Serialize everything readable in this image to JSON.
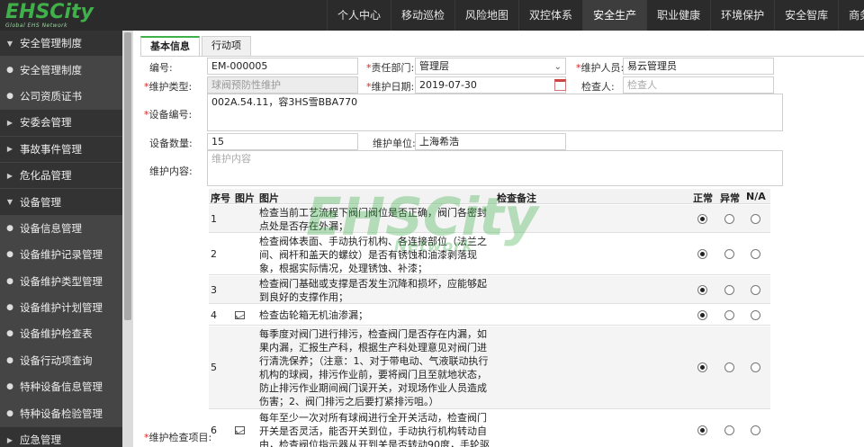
{
  "app": {
    "logo_text": "EHSCity",
    "logo_subtitle": "Global EHS Network"
  },
  "nav": {
    "items": [
      {
        "label": "个人中心"
      },
      {
        "label": "移动巡检"
      },
      {
        "label": "风险地图"
      },
      {
        "label": "双控体系"
      },
      {
        "label": "安全生产"
      },
      {
        "label": "职业健康"
      },
      {
        "label": "环境保护"
      },
      {
        "label": "安全智库"
      },
      {
        "label": "商务中心"
      }
    ],
    "active": "安全生产"
  },
  "sidebar": {
    "items": [
      {
        "label": "安全管理制度",
        "type": "group",
        "expanded": true
      },
      {
        "label": "安全管理制度",
        "type": "sub"
      },
      {
        "label": "公司资质证书",
        "type": "sub"
      },
      {
        "label": "安委会管理",
        "type": "group",
        "expanded": false
      },
      {
        "label": "事故事件管理",
        "type": "group",
        "expanded": false
      },
      {
        "label": "危化品管理",
        "type": "group",
        "expanded": false
      },
      {
        "label": "设备管理",
        "type": "group",
        "expanded": true
      },
      {
        "label": "设备信息管理",
        "type": "sub"
      },
      {
        "label": "设备维护记录管理",
        "type": "sub"
      },
      {
        "label": "设备维护类型管理",
        "type": "sub"
      },
      {
        "label": "设备维护计划管理",
        "type": "sub"
      },
      {
        "label": "设备维护检查表",
        "type": "sub"
      },
      {
        "label": "设备行动项查询",
        "type": "sub"
      },
      {
        "label": "特种设备信息管理",
        "type": "sub"
      },
      {
        "label": "特种设备检验管理",
        "type": "sub"
      },
      {
        "label": "应急管理",
        "type": "group",
        "expanded": false
      }
    ]
  },
  "tabs": [
    {
      "label": "基本信息",
      "active": true
    },
    {
      "label": "行动项",
      "active": false
    }
  ],
  "form": {
    "code_label": "编号:",
    "code_value": "EM-000005",
    "dept_label": "责任部门:",
    "dept_value": "管理层",
    "maintainer_label": "维护人员:",
    "maintainer_value": "易云管理员",
    "type_label": "维护类型:",
    "type_value": "球阀预防性维护",
    "date_label": "维护日期:",
    "date_value": "2019-07-30",
    "inspector_label": "检查人:",
    "inspector_placeholder": "检查人",
    "equip_code_label": "设备编号:",
    "equip_code_value": "002A.54.11，容3HS雪BBA770",
    "equip_qty_label": "设备数量:",
    "equip_qty_value": "15",
    "unit_label": "维护单位:",
    "unit_value": "上海希浩",
    "content_label": "维护内容:",
    "content_placeholder": "维护内容",
    "check_items_label": "维护检查项目:"
  },
  "table": {
    "headers": {
      "no": "序号",
      "image": "图片",
      "item": "图片",
      "remark": "检查备注",
      "normal": "正常",
      "abnormal": "异常",
      "na": "N/A"
    },
    "rows": [
      {
        "no": "1",
        "has_image": false,
        "text": "检查当前工艺流程下阀门阀位是否正确，阀门各密封点处是否存在外漏；",
        "status": "normal"
      },
      {
        "no": "2",
        "has_image": false,
        "text": "检查阀体表面、手动执行机构、各连接部位（法兰之间、阀杆和盖天的螺纹）是否有锈蚀和油漆剥落现象，根据实际情况，处理锈蚀、补漆；",
        "status": "normal"
      },
      {
        "no": "3",
        "has_image": false,
        "text": "检查阀门基础或支撑是否发生沉降和损坏，应能够起到良好的支撑作用；",
        "status": "normal"
      },
      {
        "no": "4",
        "has_image": true,
        "text": "检查齿轮箱无机油渗漏；",
        "status": "normal"
      },
      {
        "no": "5",
        "has_image": false,
        "text": "每季度对阀门进行排污，检查阀门是否存在内漏，如果内漏，汇报生产科，根据生产科处理意见对阀门进行清洗保养；（注意：1、对于带电动、气液联动执行机构的球阀，排污作业前，要将阀门且至就地状态，防止排污作业期间阀门误开关，对现场作业人员造成伤害；2、阀门排污之后要打紧排污咀。）",
        "status": "normal"
      },
      {
        "no": "6",
        "has_image": true,
        "text": "每年至少一次对所有球阀进行全开关活动，检查阀门开关是否灵活，能否开关到位，手动执行机构转动自由，检查阀位指示器从开到关是否转动90度，手轮驱动轴无变形，",
        "status": "normal"
      }
    ]
  },
  "colors": {
    "header_bg": "#2b2b2b",
    "sidebar_bg": "#3c3c3c",
    "brand_green": "#3fb04a",
    "required_red": "#d9231f"
  }
}
